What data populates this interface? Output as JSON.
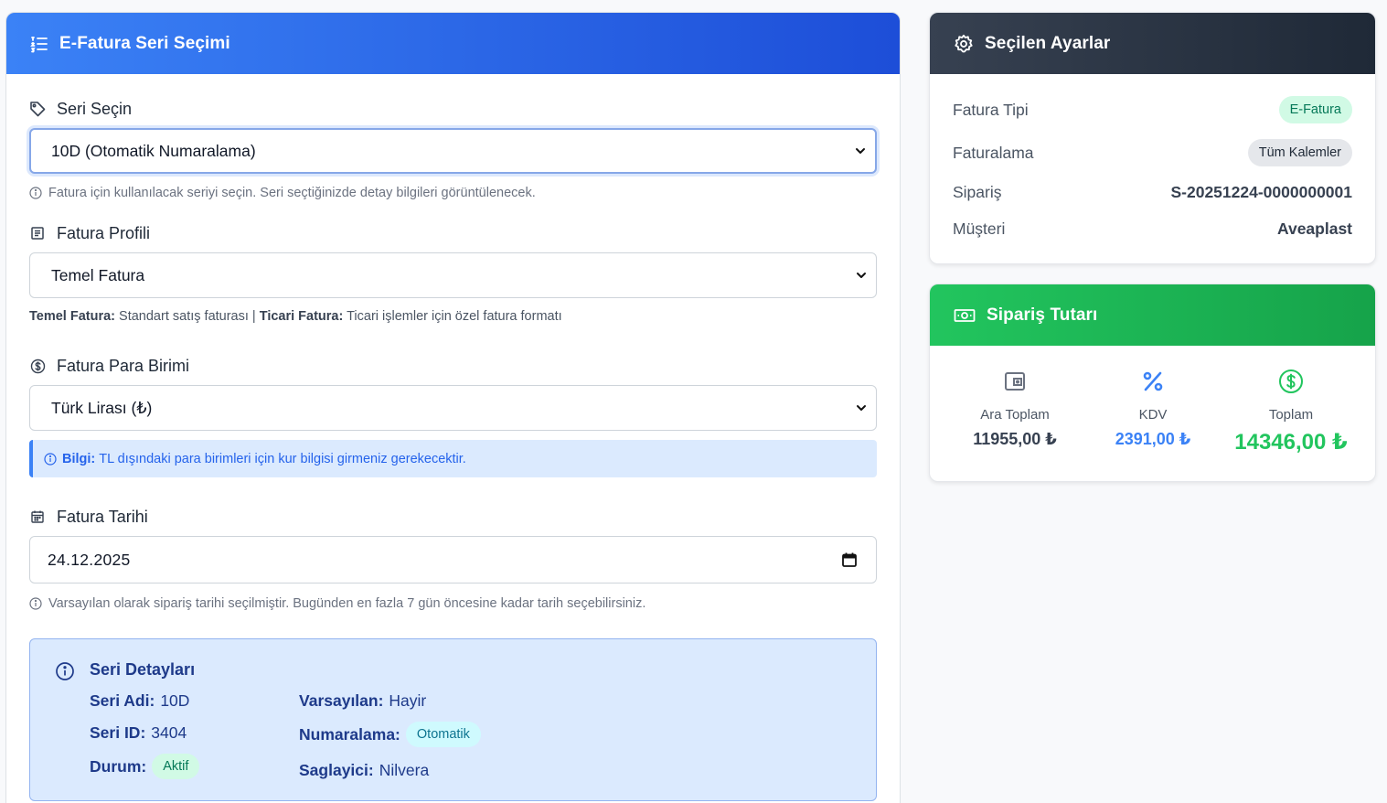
{
  "left": {
    "title": "E-Fatura Seri Seçimi",
    "series_label": "Seri Seçin",
    "series_value": "10D (Otomatik Numaralama)",
    "series_help": "Fatura için kullanılacak seriyi seçin. Seri seçtiğinizde detay bilgileri görüntülenecek.",
    "profile_label": "Fatura Profili",
    "profile_value": "Temel Fatura",
    "profile_note_t1": "Temel Fatura:",
    "profile_note_d1": " Standart satış faturası | ",
    "profile_note_t2": "Ticari Fatura:",
    "profile_note_d2": " Ticari işlemler için özel fatura formatı",
    "currency_label": "Fatura Para Birimi",
    "currency_value": "Türk Lirası (₺)",
    "currency_info_title": "Bilgi:",
    "currency_info_text": "TL dışındaki para birimleri için kur bilgisi girmeniz gerekecektir.",
    "date_label": "Fatura Tarihi",
    "date_value": "24.12.2025",
    "date_help": "Varsayılan olarak sipariş tarihi seçilmiştir. Bugünden en fazla 7 gün öncesine kadar tarih seçebilirsiniz."
  },
  "details": {
    "title": "Seri Detayları",
    "name_label": "Seri Adi:",
    "name_value": "10D",
    "id_label": "Seri ID:",
    "id_value": "3404",
    "status_label": "Durum:",
    "status_value": "Aktif",
    "default_label": "Varsayılan:",
    "default_value": "Hayir",
    "numbering_label": "Numaralama:",
    "numbering_value": "Otomatik",
    "provider_label": "Saglayici:",
    "provider_value": "Nilvera"
  },
  "settings": {
    "title": "Seçilen Ayarlar",
    "invoice_type_label": "Fatura Tipi",
    "invoice_type_value": "E-Fatura",
    "billing_label": "Faturalama",
    "billing_value": "Tüm Kalemler",
    "order_label": "Sipariş",
    "order_value": "S-20251224-0000000001",
    "customer_label": "Müşteri",
    "customer_value": "Aveaplast"
  },
  "totals": {
    "title": "Sipariş Tutarı",
    "subtotal_label": "Ara Toplam",
    "subtotal_value": "11955,00 ₺",
    "vat_label": "KDV",
    "vat_value": "2391,00 ₺",
    "total_label": "Toplam",
    "total_value": "14346,00 ₺"
  },
  "colors": {
    "primary": "#3b82f6",
    "dark_header": "#1f2937",
    "success": "#22c55e"
  },
  "icons": {
    "series_header": "list-icon",
    "series": "tag-icon",
    "profile": "document-icon",
    "currency": "dollar-circle-icon",
    "date": "calendar-icon",
    "details": "info-circle-icon",
    "settings": "gear-icon",
    "totals": "money-icon",
    "subtotal": "wallet-icon",
    "vat": "percent-icon",
    "total": "dollar-circle-icon"
  }
}
